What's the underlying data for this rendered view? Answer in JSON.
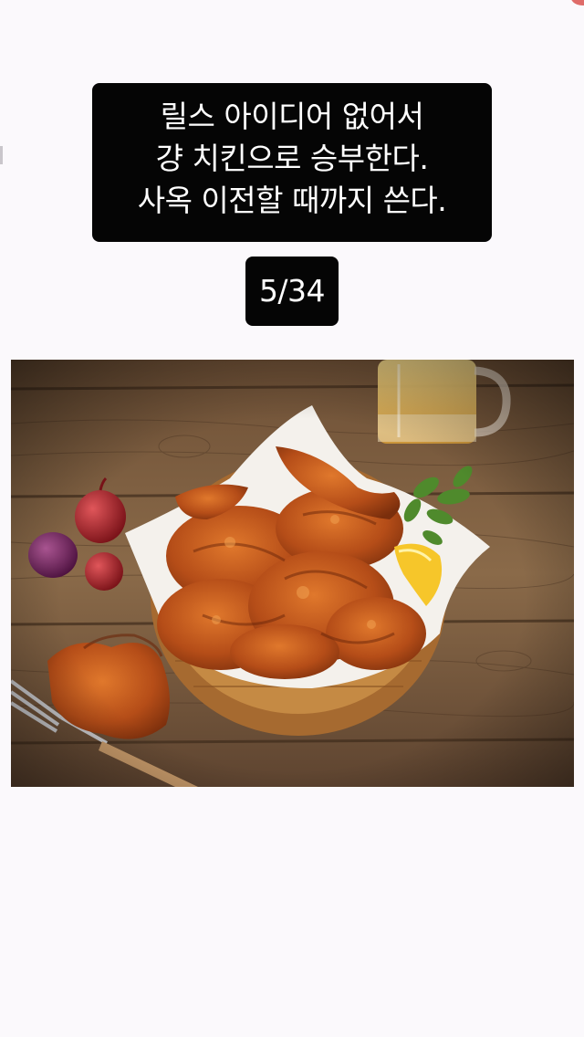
{
  "caption": {
    "lines": [
      "릴스 아이디어 없어서",
      "걍 치킨으로 승부한다.",
      "사옥 이전할 때까지 쓴다."
    ]
  },
  "counter": {
    "text": "5/34"
  },
  "photo": {
    "subject": "fried chicken in a wooden bowl with beer, onions, lemon and fork on a wooden table"
  }
}
